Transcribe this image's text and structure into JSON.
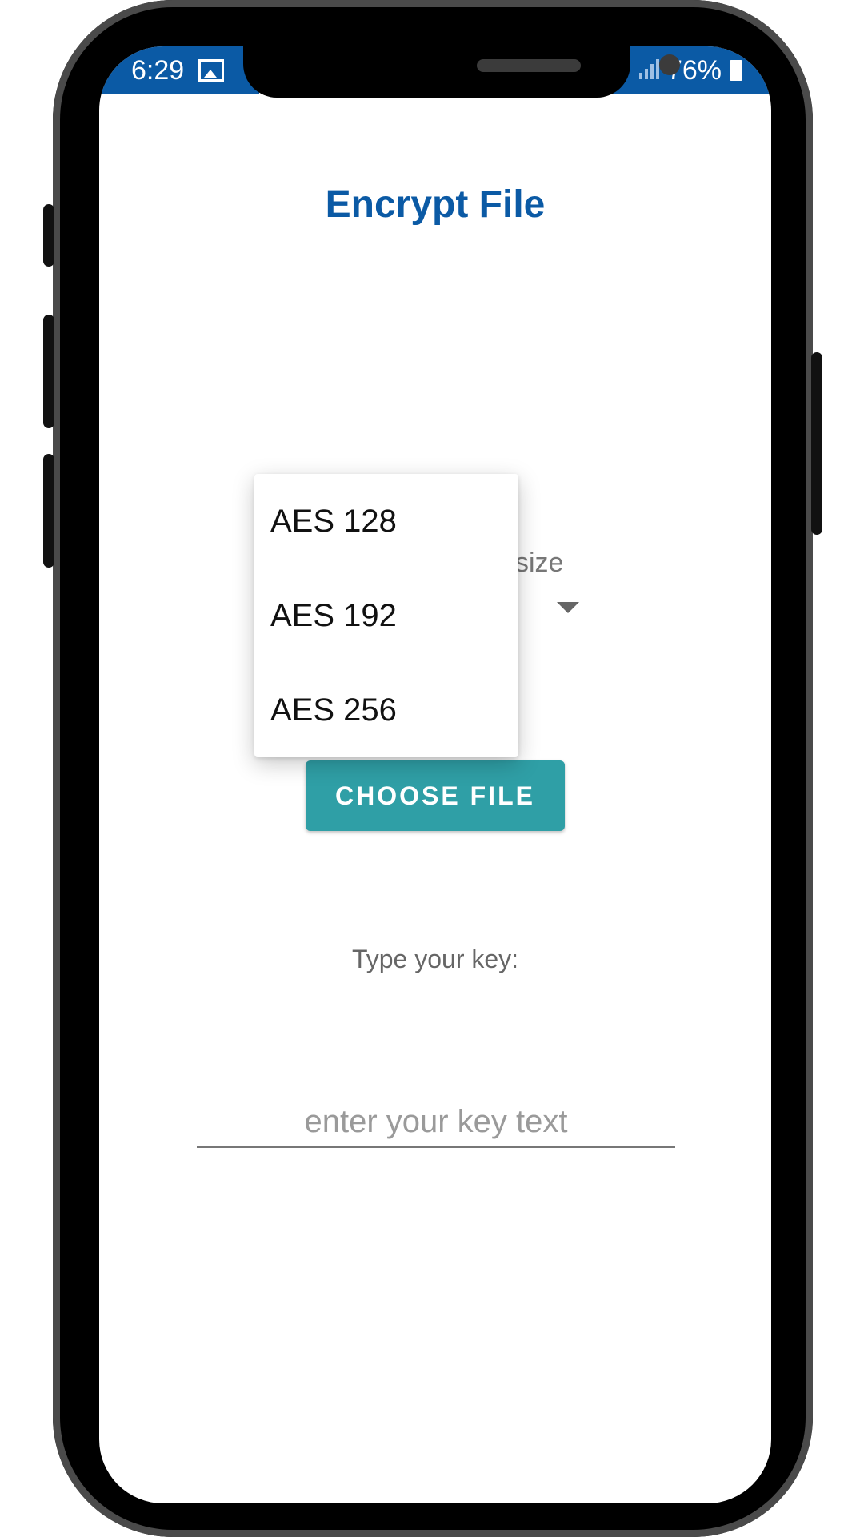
{
  "status_bar": {
    "time": "6:29",
    "battery": "76%",
    "icons": [
      "image-icon",
      "signal-icon",
      "battery-icon"
    ]
  },
  "screen": {
    "title": "Encrypt File",
    "key_size_label_partial": "size",
    "dropdown": {
      "options": [
        "AES 128",
        "AES 192",
        "AES 256"
      ]
    },
    "choose_file_label": "CHOOSE FILE",
    "type_key_label": "Type your key:",
    "key_input": {
      "placeholder": "enter your key text",
      "value": ""
    }
  },
  "colors": {
    "status_bar": "#0b5aa5",
    "title": "#0b5aa5",
    "button": "#2f9fa6"
  }
}
